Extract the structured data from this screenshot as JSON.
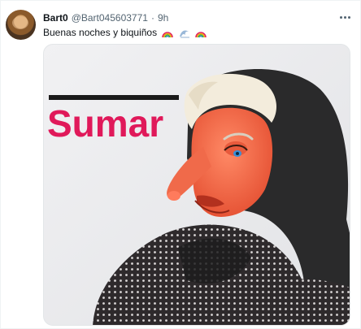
{
  "tweet": {
    "display_name": "Bart0",
    "handle": "@Bart045603771",
    "separator": "·",
    "time": "9h",
    "text": "Buenas noches y biquiños",
    "emojis": [
      "rainbow-icon",
      "wave-icon",
      "rainbow-icon"
    ]
  },
  "media": {
    "overlay_text": "Sumar",
    "brand_color": "#e0195a"
  }
}
